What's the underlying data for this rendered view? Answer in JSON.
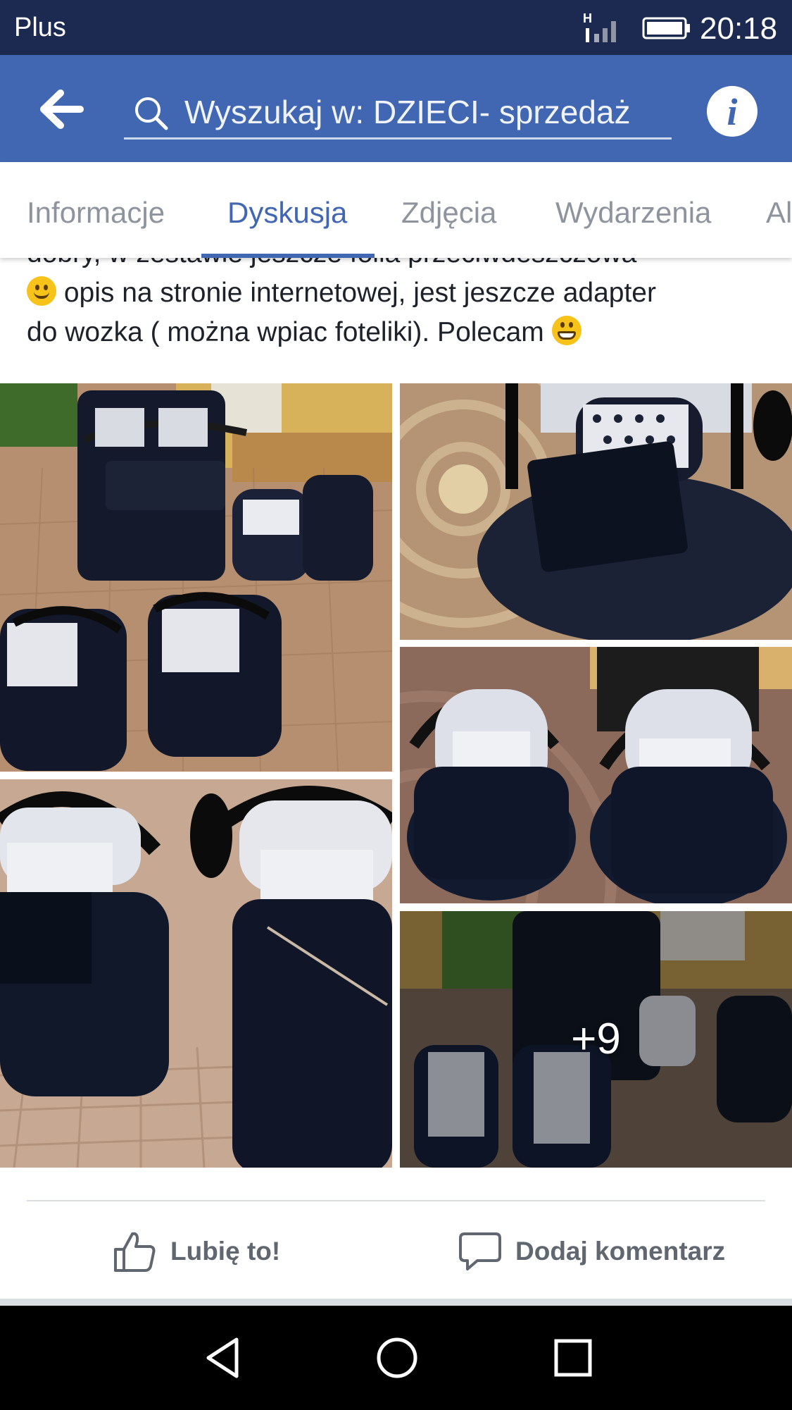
{
  "status_bar": {
    "carrier": "Plus",
    "network_type": "H",
    "time": "20:18",
    "icons": [
      "signal-icon",
      "battery-icon"
    ]
  },
  "app_bar": {
    "back_icon": "arrow-left-icon",
    "search_icon": "search-icon",
    "search_placeholder": "Wyszukaj w: DZIECI- sprzedaż",
    "info_icon": "info-icon",
    "info_glyph": "i",
    "background_color": "#4267b2"
  },
  "tabs": {
    "items": [
      {
        "label": "Informacje"
      },
      {
        "label": "Dyskusja"
      },
      {
        "label": "Zdjęcia"
      },
      {
        "label": "Wydarzenia"
      },
      {
        "label": "Al"
      }
    ],
    "active": "Dyskusja",
    "accent_color": "#4267b2"
  },
  "post": {
    "text_lines": [
      "dobry,  w zestawie jeszcze folia przeciwdeszczowa",
      " opis na stronie internetowej,  jest jeszcze adapter",
      "do wozka ( można wpiac foteliki).  Polecam "
    ],
    "emojis": [
      "slightly-smiling-face-icon",
      "grinning-face-icon"
    ],
    "photos": {
      "alt": [
        "twin stroller set with two car seats on paved driveway",
        "car seat with black footmuff",
        "two car seats side by side",
        "two car seats with footmuffs close up",
        "stroller set overview"
      ],
      "more_count": "+9"
    }
  },
  "actions": {
    "like_label": "Lubię to!",
    "like_icon": "thumbs-up-icon",
    "comment_label": "Dodaj komentarz",
    "comment_icon": "comment-bubble-icon"
  },
  "nav_bar": {
    "icons": [
      "back-triangle-icon",
      "home-circle-icon",
      "recents-square-icon"
    ]
  }
}
